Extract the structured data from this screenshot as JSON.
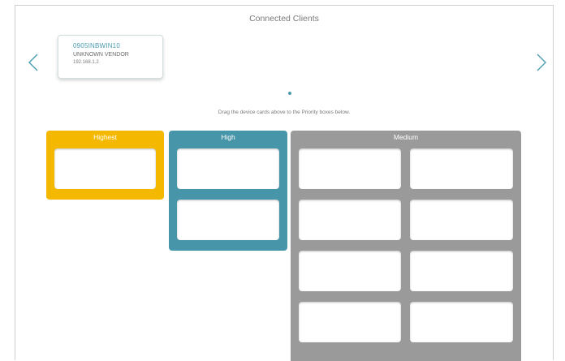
{
  "header": {
    "title": "Connected Clients"
  },
  "nav": {
    "prev_icon": "chevron-left-icon",
    "next_icon": "chevron-right-icon"
  },
  "client": {
    "name": "0905INBWIN10",
    "vendor": "UNKNOWN VENDOR",
    "ip": "192.168.1.2"
  },
  "pager": {
    "pages": 1,
    "current": 1
  },
  "instructions": "Drag the device cards above to the Priority boxes below.",
  "priority": {
    "highest": {
      "label": "Highest",
      "color": "#f5b800"
    },
    "high": {
      "label": "High",
      "color": "#4795a8"
    },
    "medium": {
      "label": "Medium",
      "color": "#9a9a9a"
    }
  },
  "colors": {
    "accent": "#4a9cb0"
  }
}
